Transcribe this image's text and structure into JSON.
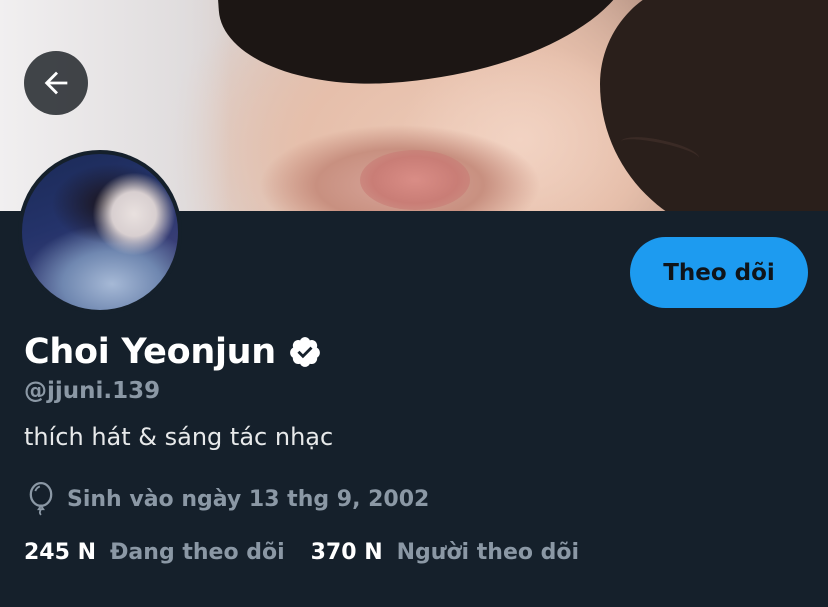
{
  "header": {
    "back_icon": "arrow-left-icon"
  },
  "profile": {
    "display_name": "Choi Yeonjun",
    "verified_icon": "verified-badge-icon",
    "handle": "@jjuni.139",
    "bio": "thích hát & sáng tác nhạc",
    "birth_icon": "balloon-icon",
    "birth_text": "Sinh vào ngày 13 thg 9, 2002",
    "follow_label": "Theo dõi"
  },
  "stats": {
    "following_count": "245 N",
    "following_label": "Đang theo dõi",
    "followers_count": "370 N",
    "followers_label": "Người theo dõi"
  },
  "colors": {
    "background": "#15202b",
    "accent": "#1d9bf0",
    "secondary_text": "#8b98a5"
  }
}
